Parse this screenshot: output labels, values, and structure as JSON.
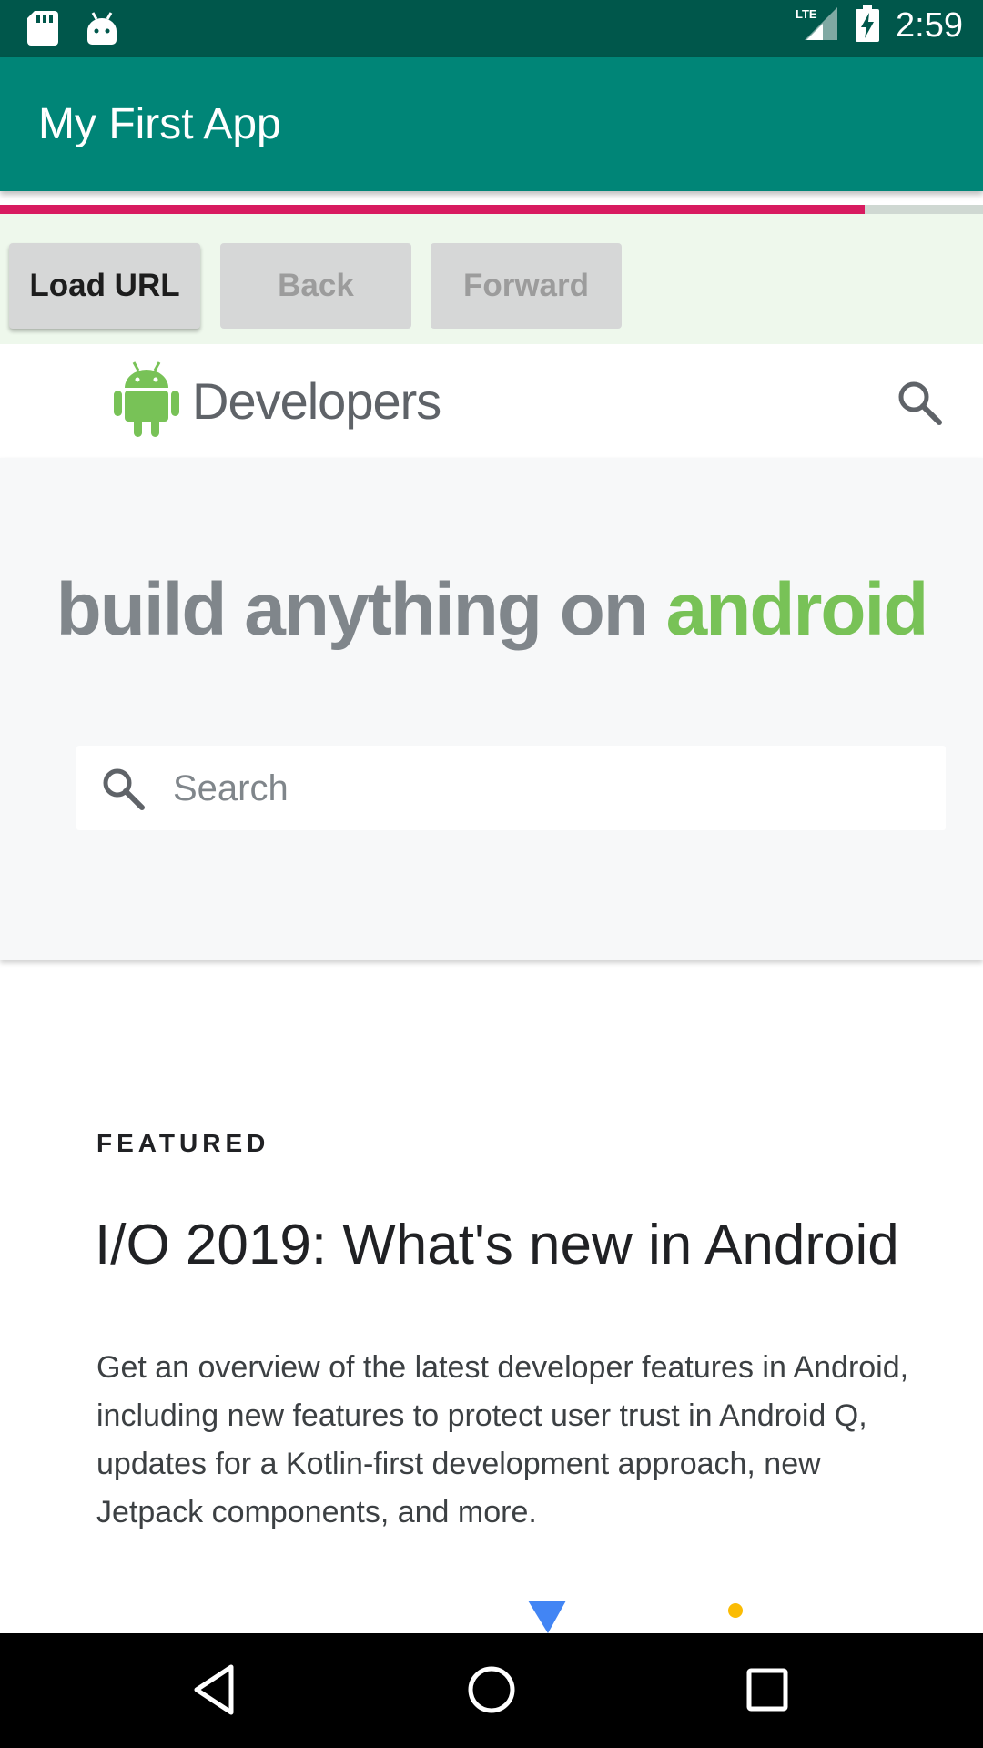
{
  "status_bar": {
    "time": "2:59",
    "icons": [
      "sd-card-icon",
      "android-debug-icon",
      "lte-signal-icon",
      "battery-charging-icon"
    ],
    "network_label": "LTE"
  },
  "app_bar": {
    "title": "My First App"
  },
  "page_load_progress": 0.88,
  "buttons": {
    "load_url": "Load URL",
    "back": "Back",
    "forward": "Forward"
  },
  "web_page": {
    "brand": "Developers",
    "hero": {
      "title_main": "build anything on ",
      "title_accent": "android",
      "search_placeholder": "Search"
    },
    "featured": {
      "label": "FEATURED",
      "title": "I/O 2019: What's new in Android",
      "description": "Get an overview of the latest developer features in Android, including new features to protect user trust in Android Q, updates for a Kotlin-first development approach, new Jetpack components, and more."
    }
  },
  "colors": {
    "status_bar": "#00574B",
    "app_bar": "#008577",
    "progress": "#D81B60",
    "android_green": "#78C257"
  },
  "nav_bar": {
    "icons": [
      "back-nav-icon",
      "home-nav-icon",
      "recents-nav-icon"
    ]
  }
}
